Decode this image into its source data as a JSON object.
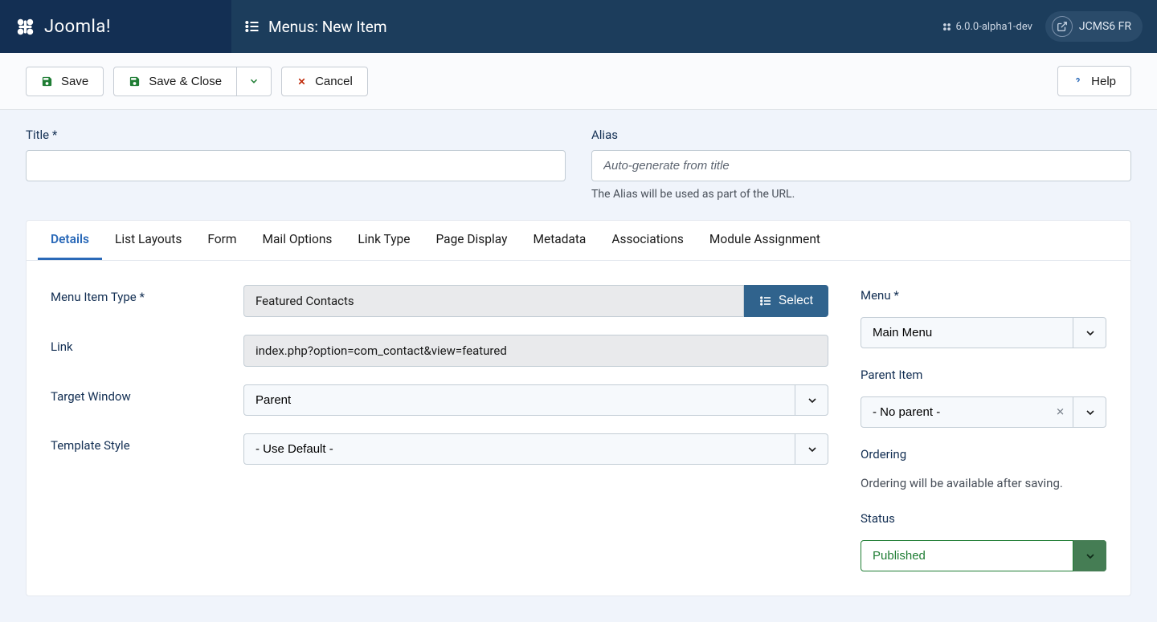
{
  "header": {
    "brand": "Joomla!",
    "page_title": "Menus: New Item",
    "version": "6.0.0-alpha1-dev",
    "user_label": "JCMS6 FR"
  },
  "toolbar": {
    "save": "Save",
    "save_close": "Save & Close",
    "cancel": "Cancel",
    "help": "Help"
  },
  "form": {
    "title_label": "Title *",
    "title_value": "",
    "alias_label": "Alias",
    "alias_placeholder": "Auto-generate from title",
    "alias_help": "The Alias will be used as part of the URL."
  },
  "tabs": [
    {
      "label": "Details",
      "active": true
    },
    {
      "label": "List Layouts",
      "active": false
    },
    {
      "label": "Form",
      "active": false
    },
    {
      "label": "Mail Options",
      "active": false
    },
    {
      "label": "Link Type",
      "active": false
    },
    {
      "label": "Page Display",
      "active": false
    },
    {
      "label": "Metadata",
      "active": false
    },
    {
      "label": "Associations",
      "active": false
    },
    {
      "label": "Module Assignment",
      "active": false
    }
  ],
  "details": {
    "menu_item_type_label": "Menu Item Type *",
    "menu_item_type_value": "Featured Contacts",
    "select_btn": "Select",
    "link_label": "Link",
    "link_value": "index.php?option=com_contact&view=featured",
    "target_window_label": "Target Window",
    "target_window_value": "Parent",
    "template_style_label": "Template Style",
    "template_style_value": "- Use Default -"
  },
  "side": {
    "menu_label": "Menu *",
    "menu_value": "Main Menu",
    "parent_label": "Parent Item",
    "parent_value": "- No parent -",
    "ordering_label": "Ordering",
    "ordering_text": "Ordering will be available after saving.",
    "status_label": "Status",
    "status_value": "Published"
  }
}
